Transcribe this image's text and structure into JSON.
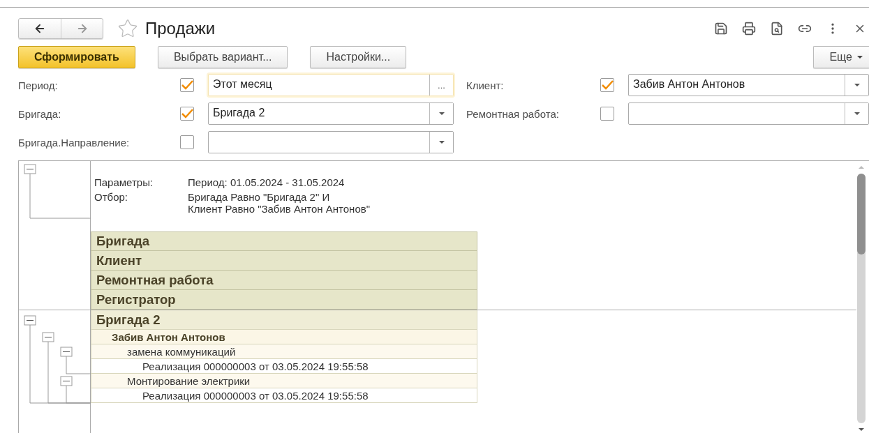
{
  "window": {
    "title": "Продажи",
    "favorite": false
  },
  "commands": [
    {
      "label": "Сформировать",
      "kind": "primary"
    },
    {
      "label": "Выбрать вариант..."
    },
    {
      "label": "Настройки..."
    }
  ],
  "more_button": {
    "label": "Еще"
  },
  "filters": [
    {
      "label": "Период:",
      "checked": true,
      "value": "Этот месяц",
      "kind": "period",
      "focused": true
    },
    {
      "label": "Клиент:",
      "checked": true,
      "value": "Забив Антон Антонов",
      "kind": "choice",
      "focused": false
    },
    {
      "label": "Бригада:",
      "checked": true,
      "value": "Бригада 2",
      "kind": "choice",
      "focused": false
    },
    {
      "label": "Ремонтная работа:",
      "checked": false,
      "kind": "choice",
      "focused": false
    },
    {
      "label": "Бригада.Направление:",
      "checked": false,
      "kind": "choice",
      "focused": false
    }
  ],
  "period_button": "...",
  "report": {
    "parameters": [
      {
        "label": "Параметры:",
        "lines": [
          "Период: 01.05.2024 - 31.05.2024"
        ]
      },
      {
        "label": "Отбор:",
        "lines": [
          "Бригада Равно \"Бригада 2\" И",
          "Клиент Равно \"Забив Антон Антонов\""
        ]
      }
    ],
    "header_rows": [
      "Бригада",
      "Клиент",
      "Ремонтная работа",
      "Регистратор"
    ],
    "rows": [
      {
        "text": "Бригада 2",
        "expanded": true,
        "children": [
          {
            "text": "Забив Антон Антонов",
            "expanded": true,
            "children": [
              {
                "text": "замена коммуникаций",
                "expanded": true,
                "children": [
                  {
                    "text": "Реализация 000000003 от 03.05.2024 19:55:58"
                  }
                ]
              },
              {
                "text": "Монтирование электрики",
                "expanded": true,
                "children": [
                  {
                    "text": "Реализация 000000003 от 03.05.2024 19:55:58"
                  }
                ]
              }
            ]
          }
        ]
      }
    ]
  }
}
